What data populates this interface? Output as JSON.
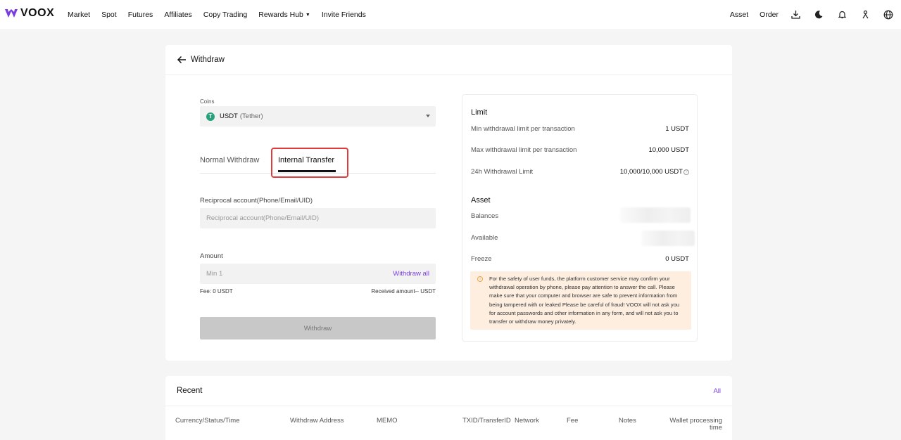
{
  "nav": {
    "brand": "VOOX",
    "links": [
      "Market",
      "Spot",
      "Futures",
      "Affiliates",
      "Copy Trading",
      "Rewards Hub",
      "Invite Friends"
    ],
    "right_links": [
      "Asset",
      "Order"
    ],
    "icons": [
      "download-icon",
      "moon-icon",
      "bell-icon",
      "user-icon",
      "globe-icon"
    ]
  },
  "withdraw": {
    "title": "Withdraw",
    "coins_label": "Coins",
    "coin_code": "USDT",
    "coin_name": "(Tether)",
    "tabs": [
      "Normal Withdraw",
      "Internal Transfer"
    ],
    "active_tab": "Internal Transfer",
    "reciprocal_label": "Reciprocal account(Phone/Email/UID)",
    "reciprocal_placeholder": "Reciprocal account(Phone/Email/UID)",
    "amount_label": "Amount",
    "amount_placeholder": "Min 1",
    "withdraw_all": "Withdraw all",
    "fee": "Fee: 0 USDT",
    "received": "Received amount-- USDT",
    "submit": "Withdraw"
  },
  "limit": {
    "heading": "Limit",
    "rows": [
      {
        "label": "Min withdrawal limit per transaction",
        "value": "1 USDT"
      },
      {
        "label": "Max withdrawal limit per transaction",
        "value": "10,000 USDT"
      },
      {
        "label": "24h Withdrawal Limit",
        "value": "10,000/10,000 USDT"
      }
    ]
  },
  "asset": {
    "heading": "Asset",
    "balances_label": "Balances",
    "available_label": "Available",
    "freeze_label": "Freeze",
    "freeze_value": "0 USDT"
  },
  "notice": "For the safety of user funds, the platform customer service may confirm your withdrawal operation by phone, please pay attention to answer the call. Please make sure that your computer and browser are safe to prevent information from being tampered with or leaked Please be careful of fraud! VOOX will not ask you for account passwords and other information in any form, and will not ask you to transfer or withdraw money privately.",
  "recent": {
    "title": "Recent",
    "all": "All",
    "columns": [
      "Currency/Status/Time",
      "Withdraw Address",
      "MEMO",
      "TXID/TransferID",
      "Network",
      "Fee",
      "Notes",
      "Wallet processing time"
    ]
  },
  "colors": {
    "accent": "#7a3ee0",
    "highlight": "#e03c3c",
    "tether": "#26a17b"
  }
}
